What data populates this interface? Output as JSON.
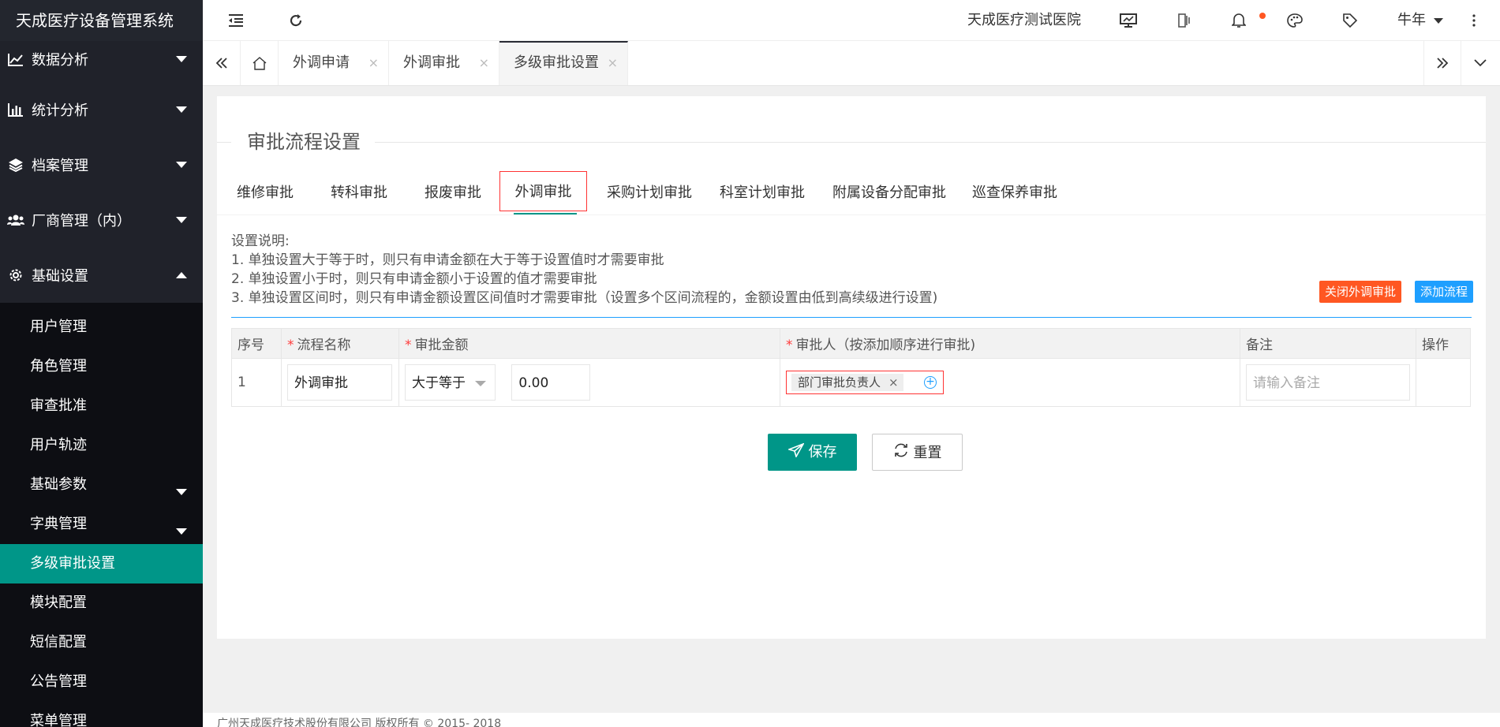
{
  "app": {
    "title": "天成医疗设备管理系统"
  },
  "sidebar": {
    "top_items": [
      {
        "label": "数据分析",
        "icon": "line-chart-icon"
      },
      {
        "label": "统计分析",
        "icon": "bar-chart-icon"
      },
      {
        "label": "档案管理",
        "icon": "layers-icon"
      },
      {
        "label": "厂商管理（内）",
        "icon": "users-icon"
      },
      {
        "label": "基础设置",
        "icon": "gear-icon"
      }
    ],
    "sub_items": [
      {
        "label": "用户管理"
      },
      {
        "label": "角色管理"
      },
      {
        "label": "审查批准"
      },
      {
        "label": "用户轨迹"
      },
      {
        "label": "基础参数"
      },
      {
        "label": "字典管理"
      },
      {
        "label": "多级审批设置"
      },
      {
        "label": "模块配置"
      },
      {
        "label": "短信配置"
      },
      {
        "label": "公告管理"
      },
      {
        "label": "菜单管理"
      }
    ]
  },
  "header": {
    "hospital": "天成医疗测试医院",
    "user": "牛年"
  },
  "tabs": [
    {
      "label": "外调申请",
      "close": "×"
    },
    {
      "label": "外调审批",
      "close": "×"
    },
    {
      "label": "多级审批设置",
      "close": "×"
    }
  ],
  "main": {
    "section_title": "审批流程设置",
    "subtabs": [
      "维修审批",
      "转科审批",
      "报废审批",
      "外调审批",
      "采购计划审批",
      "科室计划审批",
      "附属设备分配审批",
      "巡查保养审批"
    ],
    "description": [
      "设置说明:",
      "1. 单独设置大于等于时，则只有申请金额在大于等于设置值时才需要审批",
      "2. 单独设置小于时，则只有申请金额小于设置的值才需要审批",
      "3. 单独设置区间时，则只有申请金额设置区间值时才需要审批（设置多个区间流程的，金额设置由低到高续级进行设置)"
    ],
    "close_button": "关闭外调审批",
    "add_button": "添加流程",
    "table": {
      "headers": {
        "index": "序号",
        "name": "流程名称",
        "amount": "审批金额",
        "approver": "审批人（按添加顺序进行审批)",
        "remark": "备注",
        "action": "操作"
      },
      "required_mark": "*",
      "rows": [
        {
          "index": "1",
          "name": "外调审批",
          "condition": "大于等于",
          "amount": "0.00",
          "approver_tag": "部门审批负责人",
          "tag_close": "×",
          "add_symbol": "+",
          "remark_placeholder": "请输入备注"
        }
      ]
    },
    "save_button": "保存",
    "reset_button": "重置"
  },
  "footer": {
    "text": "广州天成医疗技术股份有限公司 版权所有 © 2015- 2018"
  },
  "colors": {
    "sidebar": "#20222a",
    "active": "#009688",
    "danger": "#ff5722",
    "info": "#1e9fff"
  }
}
